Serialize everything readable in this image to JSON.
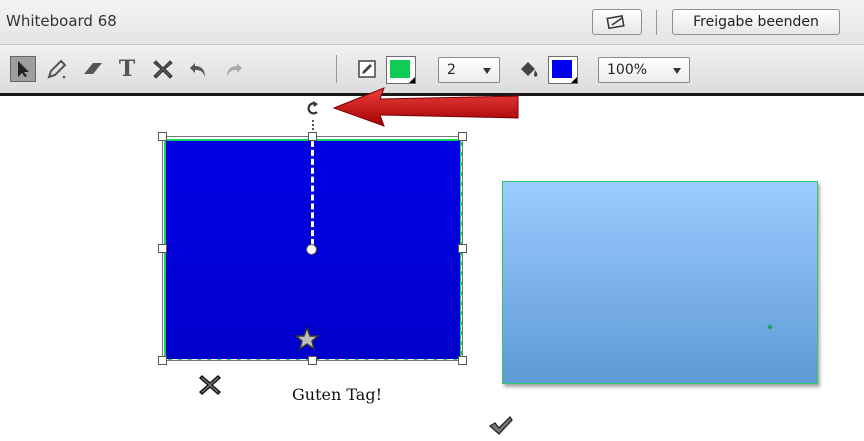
{
  "window": {
    "title": "Whiteboard 68",
    "stop_share_label": "Freigabe beenden"
  },
  "toolbar": {
    "tools": [
      {
        "name": "selection-tool",
        "icon": "arrow-cursor-icon",
        "selected": true
      },
      {
        "name": "pencil-tool",
        "icon": "pencil-icon"
      },
      {
        "name": "eraser-tool",
        "icon": "eraser-icon"
      },
      {
        "name": "text-tool",
        "icon": "text-t-icon"
      },
      {
        "name": "delete-tool",
        "icon": "cross-x-icon"
      },
      {
        "name": "undo-tool",
        "icon": "undo-icon"
      },
      {
        "name": "redo-tool",
        "icon": "redo-icon"
      }
    ],
    "text_tool_glyph": "T",
    "stroke_color": "#10cc55",
    "line_width": "2",
    "fill_color": "#0000ee",
    "zoom": "100%"
  },
  "canvas": {
    "shape1_fill": "#0000e0",
    "shape1_border": "#1bd15f",
    "shape2_fill": "#8cc0f5",
    "shape2_border": "#2ec86a",
    "text_note": "Guten Tag!",
    "annotation_arrow_color": "#cc1111"
  }
}
